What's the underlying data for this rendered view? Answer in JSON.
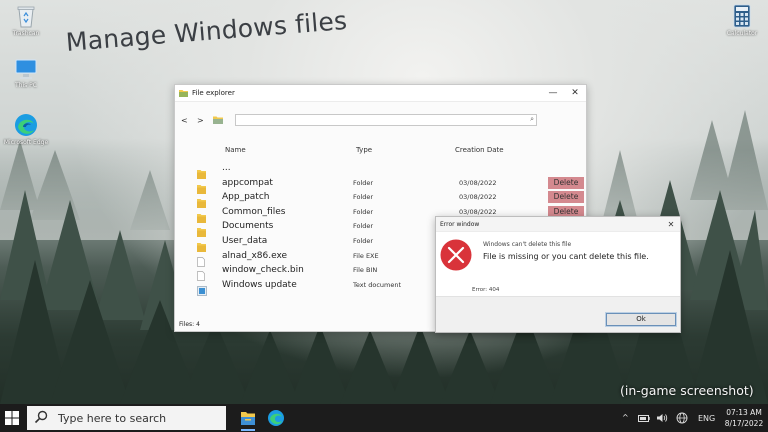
{
  "desktop": {
    "icons": [
      {
        "label": "Trashcan",
        "icon": "recycle-bin-icon"
      },
      {
        "label": "This PC",
        "icon": "monitor-icon"
      },
      {
        "label": "Microsoft Edge",
        "icon": "edge-icon"
      },
      {
        "label": "Calculator",
        "icon": "calculator-icon"
      }
    ],
    "headline": "Manage Windows files",
    "overlay_note": "(in-game screenshot)"
  },
  "explorer": {
    "title": "File explorer",
    "controls": {
      "minimize": "—",
      "close": "✕"
    },
    "nav": {
      "back": "<",
      "forward": ">"
    },
    "address_value": "",
    "columns": {
      "name": "Name",
      "type": "Type",
      "date": "Creation Date"
    },
    "rows": [
      {
        "name": "...",
        "type": "",
        "date": "",
        "icon": "folder-icon",
        "delete": ""
      },
      {
        "name": "appcompat",
        "type": "Folder",
        "date": "03/08/2022",
        "icon": "folder-icon",
        "delete": "Delete"
      },
      {
        "name": "App_patch",
        "type": "Folder",
        "date": "03/08/2022",
        "icon": "folder-icon",
        "delete": "Delete"
      },
      {
        "name": "Common_files",
        "type": "Folder",
        "date": "03/08/2022",
        "icon": "folder-icon",
        "delete": "Delete"
      },
      {
        "name": "Documents",
        "type": "Folder",
        "date": "",
        "icon": "folder-icon",
        "delete": ""
      },
      {
        "name": "User_data",
        "type": "Folder",
        "date": "",
        "icon": "folder-icon",
        "delete": ""
      },
      {
        "name": "alnad_x86.exe",
        "type": "File EXE",
        "date": "",
        "icon": "file-icon",
        "delete": ""
      },
      {
        "name": "window_check.bin",
        "type": "File BIN",
        "date": "",
        "icon": "file-icon",
        "delete": ""
      },
      {
        "name": "Windows update",
        "type": "Text document",
        "date": "",
        "icon": "text-document-icon",
        "delete": ""
      }
    ],
    "status": "Files: 4"
  },
  "error_dialog": {
    "title": "Error window",
    "close": "✕",
    "heading": "Windows can't delete this file",
    "message": "File is missing or you cant delete this file.",
    "code": "Error: 404",
    "ok_label": "Ok"
  },
  "taskbar": {
    "search_placeholder": "Type here to search",
    "language": "ENG",
    "time": "07:13 AM",
    "date": "8/17/2022"
  },
  "colors": {
    "delete_button": "#d4898f",
    "error_red": "#d9333a",
    "taskbar": "#1c1c1c"
  }
}
